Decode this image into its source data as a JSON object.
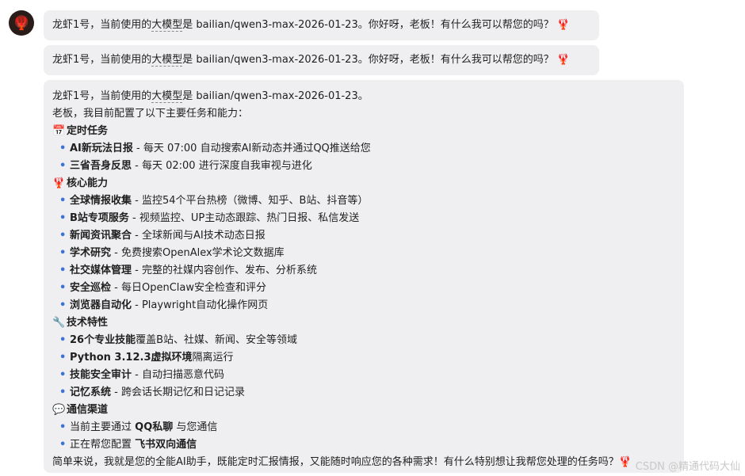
{
  "avatar": {
    "icon": "lobster-icon"
  },
  "messages": {
    "m1": {
      "prefix": "龙虾1号，当前使用的",
      "link": "大模型",
      "suffix": "是 bailian/qwen3-max-2026-01-23。你好呀，老板！有什么我可以帮您的吗？",
      "emoji": "🦞"
    },
    "m2": {
      "prefix": "龙虾1号，当前使用的",
      "link": "大模型",
      "suffix": "是 bailian/qwen3-max-2026-01-23。你好呀，老板！有什么我可以帮您的吗？",
      "emoji": "🦞"
    },
    "m3": {
      "intro_prefix": "龙虾1号，当前使用的",
      "intro_link": "大模型",
      "intro_suffix": "是 bailian/qwen3-max-2026-01-23。",
      "intro2": "老板，我目前配置了以下主要任务和能力：",
      "sections": [
        {
          "icon": "📅",
          "title": "定时任务",
          "items": [
            {
              "bold": "AI新玩法日报",
              "text": " - 每天 07:00 自动搜索AI新动态并通过QQ推送给您"
            },
            {
              "bold": "三省吾身反思",
              "text": " - 每天 02:00 进行深度自我审视与进化"
            }
          ]
        },
        {
          "icon": "🦞",
          "title": "核心能力",
          "items": [
            {
              "bold": "全球情报收集",
              "text": " - 监控54个平台热榜（微博、知乎、B站、抖音等）"
            },
            {
              "bold": "B站专项服务",
              "text": " - 视频监控、UP主动态跟踪、热门日报、私信发送"
            },
            {
              "bold": "新闻资讯聚合",
              "text": " - 全球新闻与AI技术动态日报"
            },
            {
              "bold": "学术研究",
              "text": " - 免费搜索OpenAlex学术论文数据库"
            },
            {
              "bold": "社交媒体管理",
              "text": " - 完整的社媒内容创作、发布、分析系统"
            },
            {
              "bold": "安全巡检",
              "text": " - 每日OpenClaw安全检查和评分"
            },
            {
              "bold": "浏览器自动化",
              "text": " - Playwright自动化操作网页"
            }
          ]
        },
        {
          "icon": "🔧",
          "title": "技术特性",
          "items": [
            {
              "bold": "26个专业技能",
              "text": "覆盖B站、社媒、新闻、安全等领域"
            },
            {
              "bold": "Python 3.12.3虚拟环境",
              "text": "隔离运行"
            },
            {
              "bold": "技能安全审计",
              "text": " - 自动扫描恶意代码"
            },
            {
              "bold": "记忆系统",
              "text": " - 跨会话长期记忆和日记记录"
            }
          ]
        },
        {
          "icon": "💬",
          "title": "通信渠道",
          "items": [
            {
              "bold": "",
              "text": "当前主要通过 ",
              "bold2": "QQ私聊",
              "text2": " 与您通信"
            },
            {
              "bold": "",
              "text": "正在帮您配置 ",
              "bold2": "飞书双向通信",
              "text2": ""
            }
          ]
        }
      ],
      "closing": "简单来说，我就是您的全能AI助手，既能定时汇报情报，又能随时响应您的各种需求！有什么特别想让我帮您处理的任务吗？",
      "closing_emoji": "🦞"
    }
  },
  "watermark": "CSDN @精通代码大仙"
}
